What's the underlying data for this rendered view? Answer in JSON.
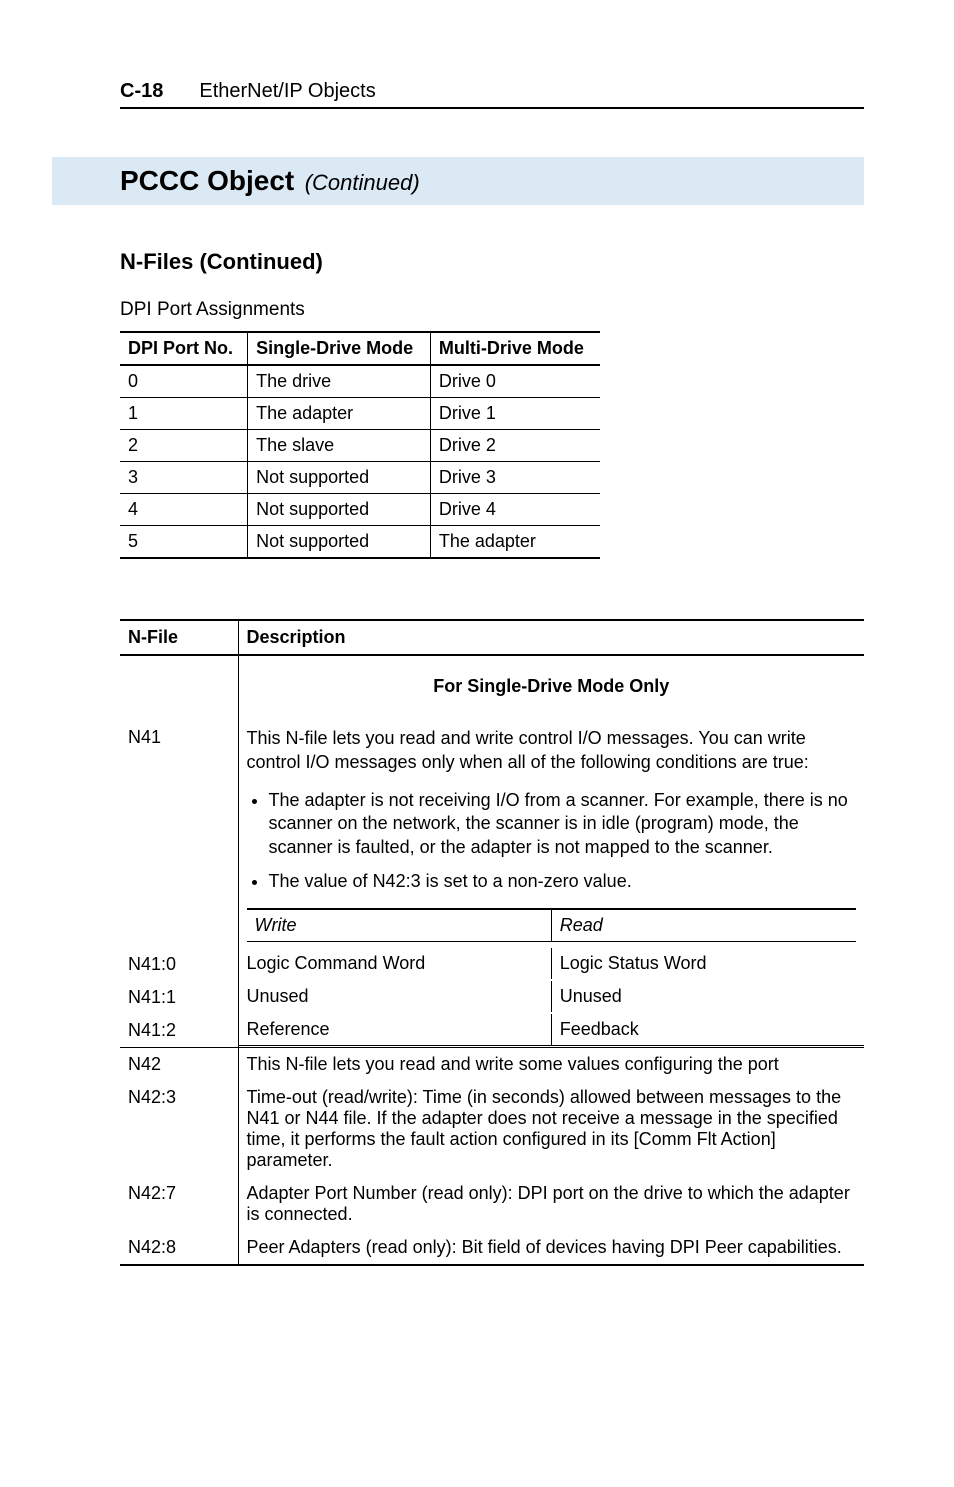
{
  "header": {
    "page_num": "C-18",
    "chapter": "EtherNet/IP Objects"
  },
  "banner": {
    "title": "PCCC Object",
    "continued": "(Continued)"
  },
  "section": "N-Files (Continued)",
  "sub": "DPI Port Assignments",
  "ports": {
    "headers": [
      "DPI Port No.",
      "Single-Drive Mode",
      "Multi-Drive Mode"
    ],
    "rows": [
      [
        "0",
        "The drive",
        "Drive 0"
      ],
      [
        "1",
        "The adapter",
        "Drive 1"
      ],
      [
        "2",
        "The slave",
        "Drive 2"
      ],
      [
        "3",
        "Not supported",
        "Drive 3"
      ],
      [
        "4",
        "Not supported",
        "Drive 4"
      ],
      [
        "5",
        "Not supported",
        "The adapter"
      ]
    ]
  },
  "desc": {
    "headers": [
      "N-File",
      "Description"
    ],
    "single_mode_head": "For Single-Drive Mode Only",
    "n41": {
      "name": "N41",
      "intro": "This N-file lets you read and write control I/O messages. You can write control I/O messages only when all of the following conditions are true:",
      "b1": "The adapter is not receiving I/O from a scanner. For example, there is no scanner on the network, the scanner is in idle (program) mode, the scanner is faulted, or the adapter is not mapped to the scanner.",
      "b2": "The value of N42:3 is set to a non-zero value."
    },
    "wr": {
      "write": "Write",
      "read": "Read"
    },
    "rows41": [
      {
        "n": "N41:0",
        "w": "Logic Command Word",
        "r": "Logic Status Word"
      },
      {
        "n": "N41:1",
        "w": "Unused",
        "r": "Unused"
      },
      {
        "n": "N41:2",
        "w": "Reference",
        "r": "Feedback"
      }
    ],
    "n42": {
      "n": "N42",
      "d": "This N-file lets you read and write some values configuring the port"
    },
    "n423": {
      "n": "N42:3",
      "d": "Time-out (read/write): Time (in seconds) allowed between messages to the N41 or N44 file. If the adapter does not receive a message in the specified time, it performs the fault action configured in its [Comm Flt Action] parameter."
    },
    "n427": {
      "n": "N42:7",
      "d": "Adapter Port Number (read only): DPI port on the drive to which the adapter is connected."
    },
    "n428": {
      "n": "N42:8",
      "d": "Peer Adapters (read only): Bit field of devices having DPI Peer capabilities."
    }
  }
}
